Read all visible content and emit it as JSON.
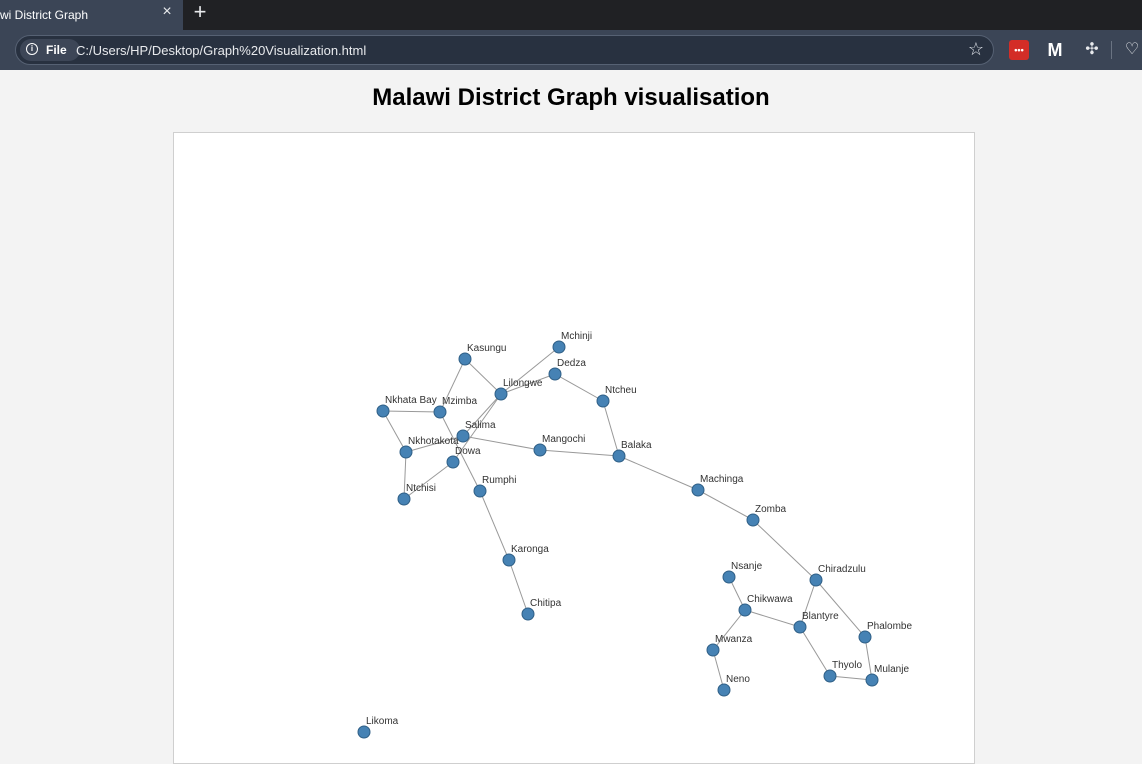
{
  "browser": {
    "tab_title": "wi District Graph",
    "tab_close": "×",
    "new_tab": "+",
    "chip_label": "File",
    "url": "C:/Users/HP/Desktop/Graph%20Visualization.html",
    "extension_lastpass_text": "•••",
    "extension_malware_text": "M",
    "icons": [
      "info-icon",
      "star-icon",
      "lastpass-icon",
      "malwarebytes-icon",
      "puzzle-icon",
      "health-icon"
    ]
  },
  "page": {
    "title": "Malawi District Graph visualisation"
  },
  "graph": {
    "nodes": [
      {
        "id": "Mchinji"
      },
      {
        "id": "Kasungu"
      },
      {
        "id": "Dedza"
      },
      {
        "id": "Lilongwe"
      },
      {
        "id": "Ntcheu"
      },
      {
        "id": "Nkhata Bay"
      },
      {
        "id": "Mzimba"
      },
      {
        "id": "Salima"
      },
      {
        "id": "Nkhotakota"
      },
      {
        "id": "Dowa"
      },
      {
        "id": "Mangochi"
      },
      {
        "id": "Balaka"
      },
      {
        "id": "Rumphi"
      },
      {
        "id": "Ntchisi"
      },
      {
        "id": "Machinga"
      },
      {
        "id": "Zomba"
      },
      {
        "id": "Karonga"
      },
      {
        "id": "Nsanje"
      },
      {
        "id": "Chiradzulu"
      },
      {
        "id": "Chikwawa"
      },
      {
        "id": "Chitipa"
      },
      {
        "id": "Blantyre"
      },
      {
        "id": "Phalombe"
      },
      {
        "id": "Mwanza"
      },
      {
        "id": "Thyolo"
      },
      {
        "id": "Mulanje"
      },
      {
        "id": "Neno"
      },
      {
        "id": "Likoma"
      }
    ],
    "links": [
      [
        "Mchinji",
        "Lilongwe"
      ],
      [
        "Kasungu",
        "Lilongwe"
      ],
      [
        "Kasungu",
        "Mzimba"
      ],
      [
        "Lilongwe",
        "Dedza"
      ],
      [
        "Lilongwe",
        "Salima"
      ],
      [
        "Lilongwe",
        "Dowa"
      ],
      [
        "Dedza",
        "Ntcheu"
      ],
      [
        "Ntcheu",
        "Balaka"
      ],
      [
        "Nkhata Bay",
        "Mzimba"
      ],
      [
        "Nkhata Bay",
        "Nkhotakota"
      ],
      [
        "Mzimba",
        "Rumphi"
      ],
      [
        "Salima",
        "Nkhotakota"
      ],
      [
        "Salima",
        "Mangochi"
      ],
      [
        "Nkhotakota",
        "Ntchisi"
      ],
      [
        "Ntchisi",
        "Dowa"
      ],
      [
        "Mangochi",
        "Balaka"
      ],
      [
        "Balaka",
        "Machinga"
      ],
      [
        "Machinga",
        "Zomba"
      ],
      [
        "Zomba",
        "Chiradzulu"
      ],
      [
        "Rumphi",
        "Karonga"
      ],
      [
        "Karonga",
        "Chitipa"
      ],
      [
        "Nsanje",
        "Chikwawa"
      ],
      [
        "Chikwawa",
        "Blantyre"
      ],
      [
        "Chikwawa",
        "Mwanza"
      ],
      [
        "Mwanza",
        "Neno"
      ],
      [
        "Chiradzulu",
        "Blantyre"
      ],
      [
        "Chiradzulu",
        "Phalombe"
      ],
      [
        "Blantyre",
        "Thyolo"
      ],
      [
        "Thyolo",
        "Mulanje"
      ],
      [
        "Phalombe",
        "Mulanje"
      ]
    ]
  }
}
